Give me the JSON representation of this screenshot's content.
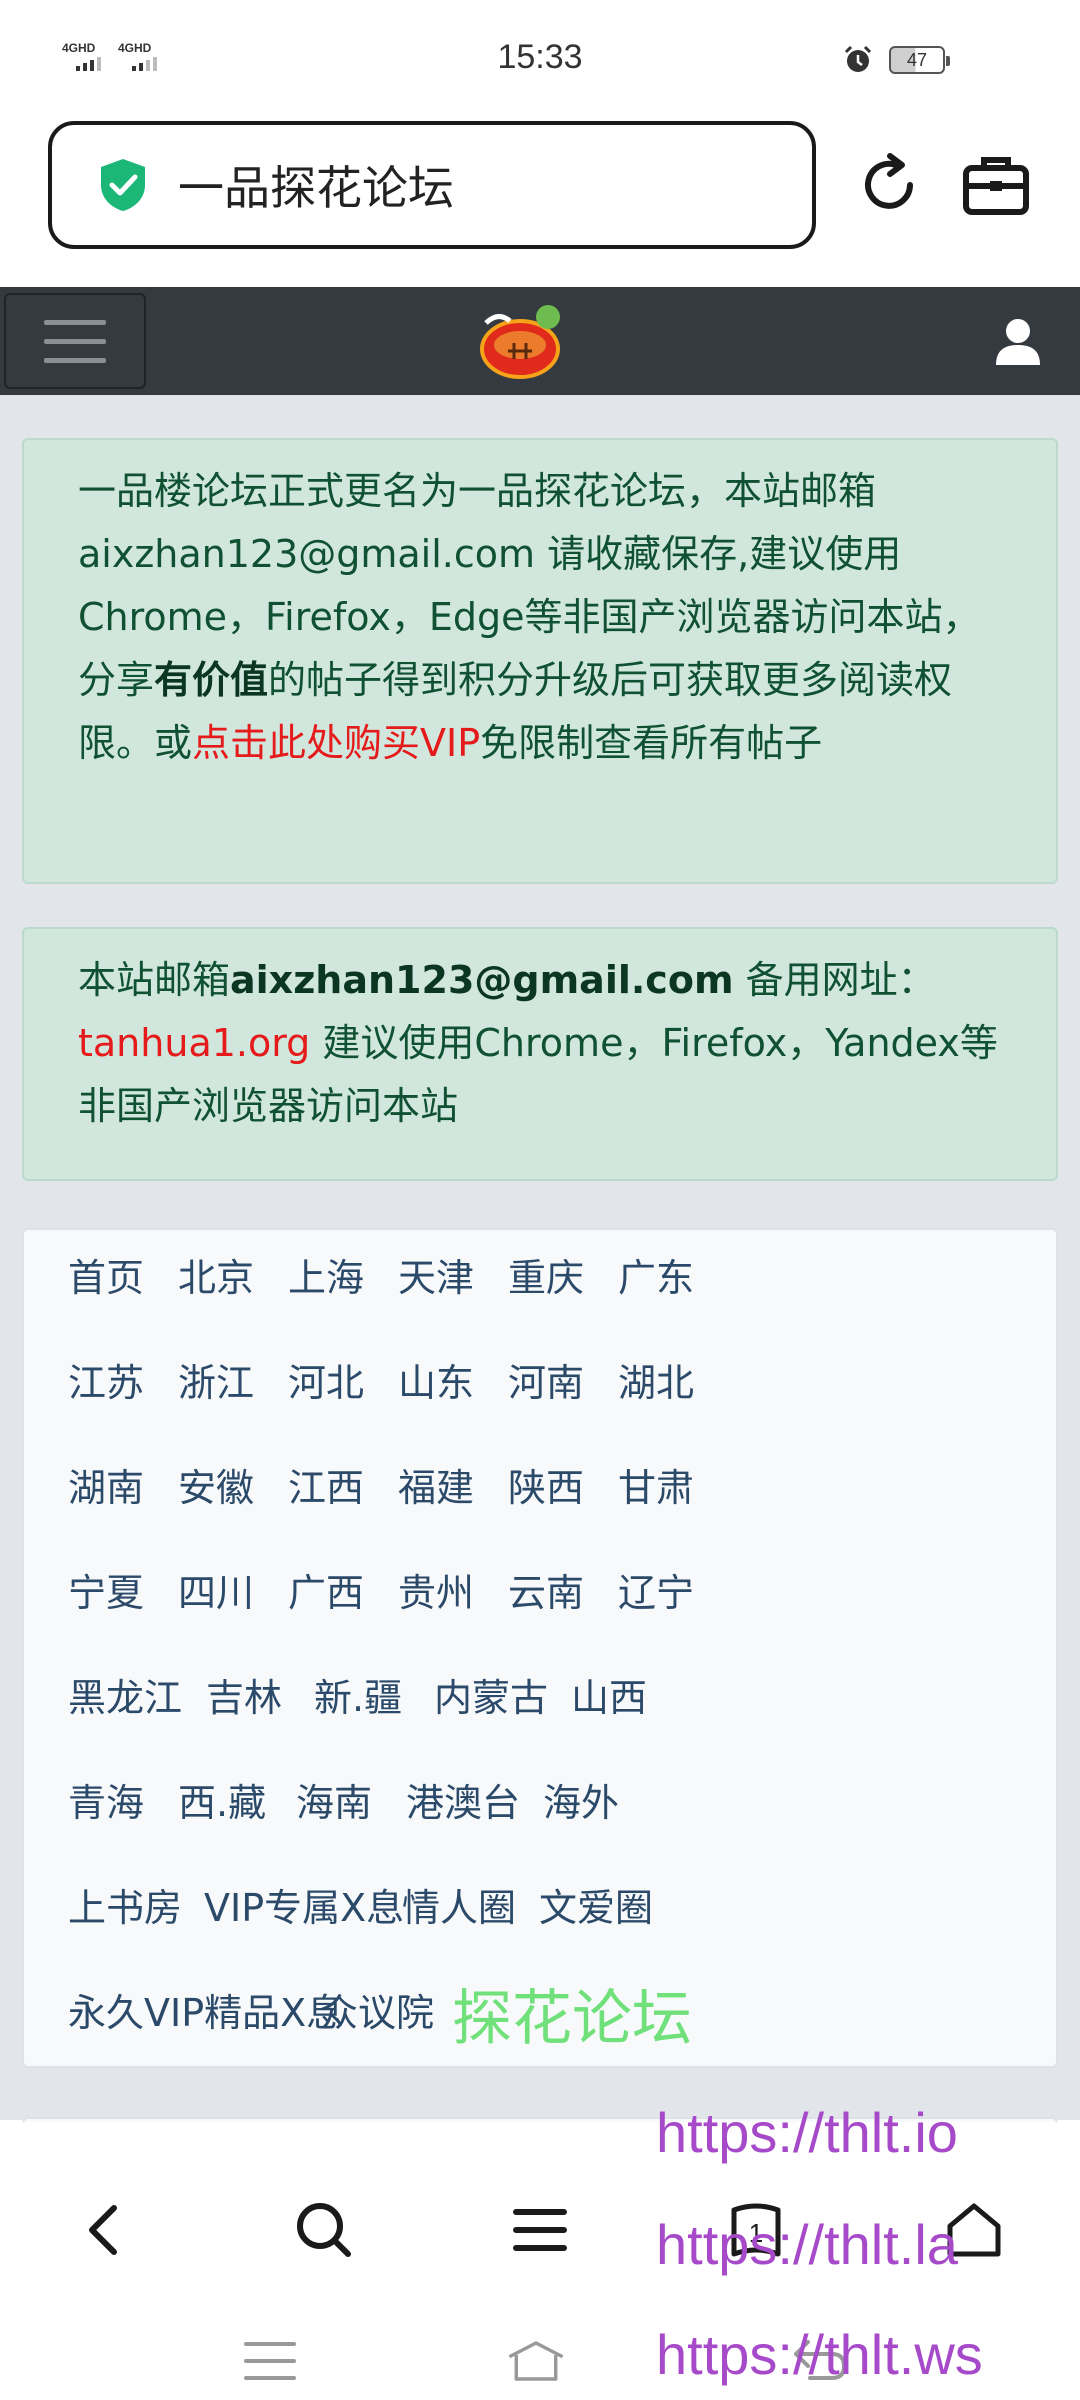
{
  "status_bar": {
    "signal1_label": "4GHD",
    "signal2_label": "4GHD",
    "time": "15:33",
    "battery_level": "47"
  },
  "address_bar": {
    "title": "一品探花论坛"
  },
  "notice1": {
    "line_part1": "一品楼论坛正式更名为一品探花论坛，本站邮箱aixzhan123@gmail.com 请收藏保存,建议使用Chrome，Firefox，Edge等非国产浏览器访问本站，分享",
    "bold": "有价值",
    "line_part2": "的帖子得到积分升级后可获取更多阅读权限。或",
    "red_link": "点击此处购买VIP",
    "line_part3": "免限制查看所有帖子"
  },
  "notice2": {
    "prefix": "本站邮箱",
    "email": "aixzhan123@gmail.com",
    "middle": " 备用网址：",
    "link": "tanhua1.org",
    "suffix": " 建议使用Chrome，Firefox，Yandex等非国产浏览器访问本站"
  },
  "regions": [
    "首页",
    "北京",
    "上海",
    "天津",
    "重庆",
    "广东",
    "江苏",
    "浙江",
    "河北",
    "山东",
    "河南",
    "湖北",
    "湖南",
    "安徽",
    "江西",
    "福建",
    "陕西",
    "甘肃",
    "宁夏",
    "四川",
    "广西",
    "贵州",
    "云南",
    "辽宁",
    "黑龙江",
    "吉林",
    "新.疆",
    "内蒙古",
    "山西",
    "青海",
    "西.藏",
    "海南",
    "港澳台",
    "海外",
    "上书房",
    "VIP专属X息",
    "情人圈",
    "文爱圈",
    "永久VIP精品X息",
    "众议院"
  ],
  "promo": "探花论坛",
  "watermark": {
    "line1": "https://thlt.io",
    "line2": "https://thlt.la",
    "line3": "https://thlt.ws"
  },
  "bottom_bar": {
    "tabs_count": "1"
  }
}
